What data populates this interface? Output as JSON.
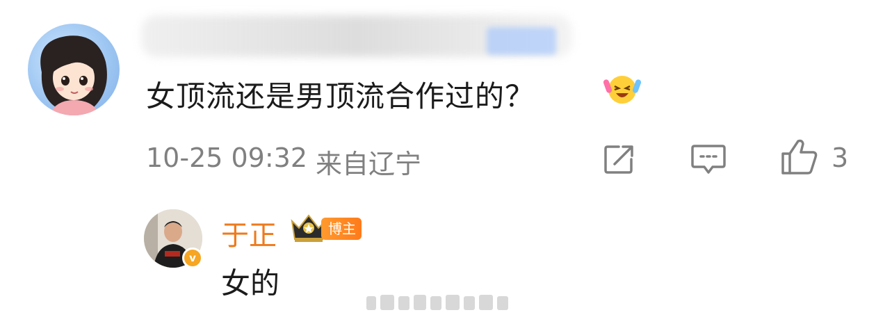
{
  "comment": {
    "text": "女顶流还是男顶流合作过的？",
    "emoji": "laugh-cry-emoji",
    "time": "10-25 09:32",
    "location": "来自辽宁",
    "like_count": "3"
  },
  "reply": {
    "username": "于正",
    "badge": "博主",
    "verified_mark": "v",
    "text": "女的"
  },
  "colors": {
    "reply_name": "#ee7a1b",
    "badge_bg": "#ff8a22",
    "meta_gray": "#808080"
  }
}
